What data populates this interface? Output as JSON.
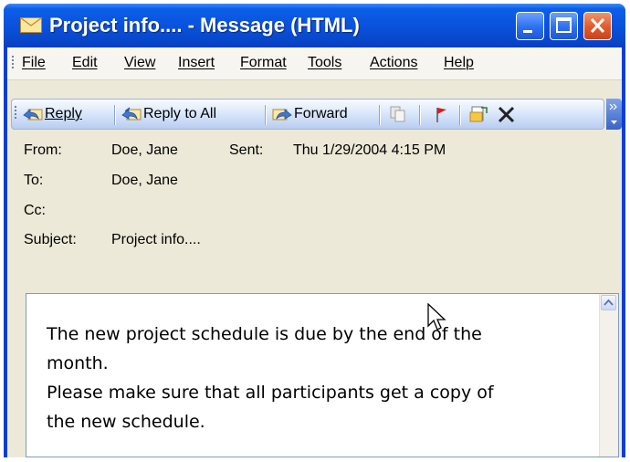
{
  "window": {
    "title": "Project info.... - Message (HTML)",
    "buttons": [
      "minimize",
      "maximize",
      "close"
    ]
  },
  "menu": {
    "items": [
      {
        "label": "File"
      },
      {
        "label": "Edit"
      },
      {
        "label": "View"
      },
      {
        "label": "Insert"
      },
      {
        "label": "Format"
      },
      {
        "label": "Tools"
      },
      {
        "label": "Actions"
      },
      {
        "label": "Help"
      }
    ]
  },
  "toolbar": {
    "reply": "Reply",
    "reply_all": "Reply to All",
    "forward": "Forward",
    "icons": [
      "copy-icon",
      "flag-icon",
      "move-icon",
      "delete-icon"
    ]
  },
  "header": {
    "from_label": "From:",
    "from_value": "Doe, Jane",
    "sent_label": "Sent:",
    "sent_value": "Thu 1/29/2004 4:15 PM",
    "to_label": "To:",
    "to_value": "Doe, Jane",
    "cc_label": "Cc:",
    "cc_value": "",
    "subject_label": "Subject:",
    "subject_value": "Project info...."
  },
  "message": {
    "line1": "The new project schedule is due by the end of the",
    "line2": "month.",
    "line3": "Please make sure that all participants get a copy of",
    "line4": "the new schedule."
  },
  "colors": {
    "titlebar": "#0a52dd",
    "close_button": "#e05a2c",
    "client_bg": "#ece9d8"
  }
}
